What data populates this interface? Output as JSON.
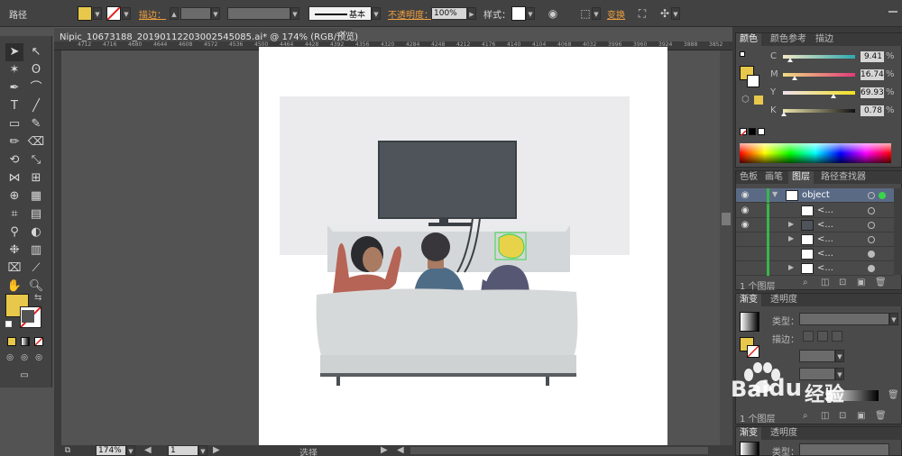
{
  "control_bar": {
    "object_label": "路径",
    "stroke_label": "描边：",
    "stroke_style_label": "基本",
    "opacity_label": "不透明度：",
    "opacity_value": "100%",
    "style_label": "样式：",
    "transform_label": "变换",
    "fill_color": "#e8c84a"
  },
  "document": {
    "tab_title": "Nipic_10673188_20190112203002545085.ai* @ 174% (RGB/预览)",
    "close_glyph": "×",
    "ruler_ticks": [
      "4712",
      "4716",
      "4680",
      "4644",
      "4608",
      "4572",
      "4536",
      "4500",
      "4464",
      "4428",
      "4392",
      "4356",
      "4320",
      "4284",
      "4248",
      "4212",
      "4176",
      "4140",
      "4104",
      "4068",
      "4032",
      "3996",
      "3960",
      "3924",
      "3888",
      "3852"
    ]
  },
  "status_bar": {
    "zoom_value": "174%",
    "page_value": "1",
    "selection_text": "选择"
  },
  "color_panel": {
    "tabs": [
      "颜色",
      "颜色参考",
      "描边"
    ],
    "channels": [
      {
        "name": "C",
        "value": "9.41",
        "unit": "%",
        "level": 0.094
      },
      {
        "name": "M",
        "value": "16.74",
        "unit": "%",
        "level": 0.167
      },
      {
        "name": "Y",
        "value": "69.93",
        "unit": "%",
        "level": 0.699
      },
      {
        "name": "K",
        "value": "0.78",
        "unit": "%",
        "level": 0.008
      }
    ]
  },
  "layers_panel": {
    "tabs": [
      "色板",
      "画笔",
      "图层",
      "路径查找器"
    ],
    "layer_name": "object",
    "sublayer_label": "<...",
    "count_label": "1 个图层"
  },
  "gradient_panel": {
    "tabs": [
      "渐变",
      "透明度"
    ],
    "type_label": "类型：",
    "stroke_label": "描边："
  },
  "gradient_panel2": {
    "tabs": [
      "渐变",
      "透明度"
    ],
    "type_label": "类型："
  },
  "layers_count_bottom": "1 个图层",
  "watermark": {
    "brand": "Bai",
    "text": "du",
    "suffix": "经验"
  },
  "colors": {
    "accent_yellow": "#e8c84a",
    "panel_bg": "#4a4a4a",
    "tv": "#4e5459",
    "shirt_red": "#b66456",
    "shirt_blue": "#4f6c86",
    "sofa": "#d6d9da"
  }
}
